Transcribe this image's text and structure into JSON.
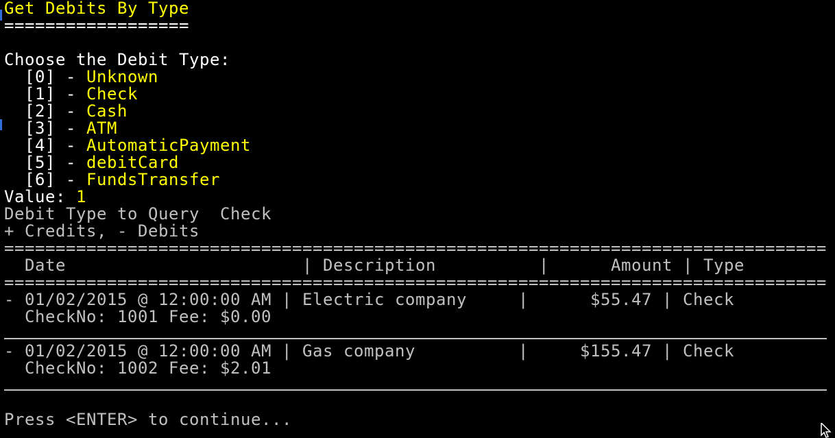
{
  "header": {
    "title": "Get Debits By Type",
    "underline": "=================="
  },
  "menu": {
    "prompt": "Choose the Debit Type:",
    "options": [
      {
        "index": "[0]",
        "sep": " - ",
        "label": "Unknown"
      },
      {
        "index": "[1]",
        "sep": " - ",
        "label": "Check"
      },
      {
        "index": "[2]",
        "sep": " - ",
        "label": "Cash"
      },
      {
        "index": "[3]",
        "sep": " - ",
        "label": "ATM"
      },
      {
        "index": "[4]",
        "sep": " - ",
        "label": "AutomaticPayment"
      },
      {
        "index": "[5]",
        "sep": " - ",
        "label": "debitCard"
      },
      {
        "index": "[6]",
        "sep": " - ",
        "label": "FundsTransfer"
      }
    ]
  },
  "input": {
    "label": "Value: ",
    "value": "1"
  },
  "query": {
    "text": "Debit Type to Query  Check",
    "legend": "+ Credits, - Debits"
  },
  "table": {
    "rule": "================================================================================",
    "header": "  Date                       | Description          |      Amount | Type",
    "rows": [
      {
        "line1": "- 01/02/2015 @ 12:00:00 AM | Electric company     |      $55.47 | Check",
        "line2": "  CheckNo: 1001 Fee: $0.00"
      },
      {
        "line1": "- 01/02/2015 @ 12:00:00 AM | Gas company          |     $155.47 | Check",
        "line2": "  CheckNo: 1002 Fee: $2.01"
      }
    ]
  },
  "footer": {
    "prompt": "Press <ENTER> to continue..."
  },
  "colors": {
    "background": "#000000",
    "highlight": "#FFFF00",
    "text": "#C0C0C0",
    "bright": "#FFFFFF"
  },
  "icons": {
    "cursor": "mouse-pointer-icon"
  }
}
